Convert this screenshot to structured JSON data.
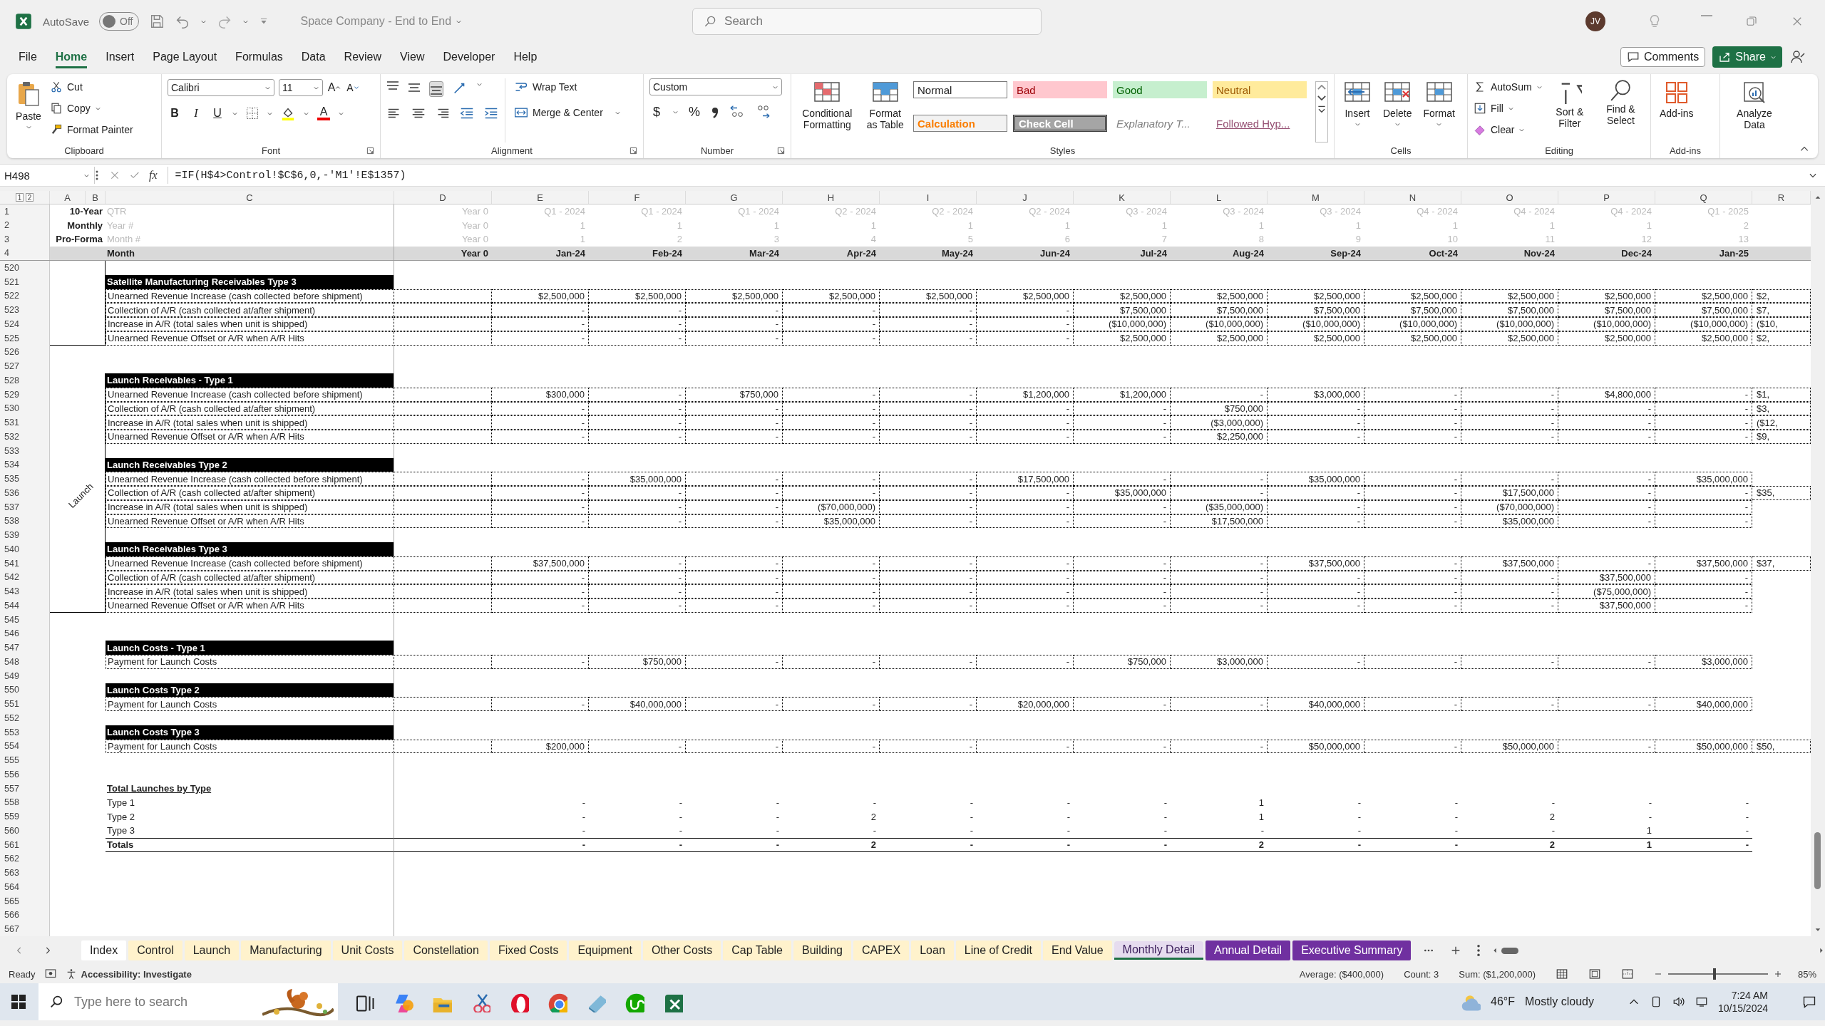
{
  "titlebar": {
    "autosave": "AutoSave",
    "autosave_on": false,
    "toggle": "Off",
    "title": "Space Company - End to End",
    "search": {
      "placeholder": "Search"
    },
    "avatar": "JV"
  },
  "menu_tabs": [
    {
      "label": "File",
      "selected": false
    },
    {
      "label": "Home",
      "selected": true
    },
    {
      "label": "Insert",
      "selected": false
    },
    {
      "label": "Page Layout",
      "selected": false
    },
    {
      "label": "Formulas",
      "selected": false
    },
    {
      "label": "Data",
      "selected": false
    },
    {
      "label": "Review",
      "selected": false
    },
    {
      "label": "View",
      "selected": false
    },
    {
      "label": "Developer",
      "selected": false
    },
    {
      "label": "Help",
      "selected": false
    }
  ],
  "comments": "Comments",
  "share": "Share",
  "ribbon": {
    "clipboard": {
      "paste": "Paste",
      "cut": "Cut",
      "copy": "Copy",
      "format_painter": "Format Painter",
      "label": "Clipboard"
    },
    "font": {
      "family": "Calibri",
      "size": "11",
      "grow": "A",
      "shrink": "A",
      "bold": "B",
      "italic": "I",
      "underline": "U",
      "font_color": "A",
      "label": "Font"
    },
    "alignment": {
      "wrap": "Wrap Text",
      "merge": "Merge & Center",
      "label": "Alignment"
    },
    "number": {
      "format": "Custom",
      "currency": "$",
      "percent": "%",
      "label": "Number"
    },
    "styles": {
      "conditional": "Conditional Formatting",
      "format_table": "Format as Table",
      "cells": [
        {
          "label": "Normal",
          "kind": "normal"
        },
        {
          "label": "Bad",
          "kind": "bad"
        },
        {
          "label": "Good",
          "kind": "good"
        },
        {
          "label": "Neutral",
          "kind": "neutral"
        },
        {
          "label": "Calculation",
          "kind": "calculation"
        },
        {
          "label": "Check Cell",
          "kind": "check"
        },
        {
          "label": "Explanatory T...",
          "kind": "explanatory"
        },
        {
          "label": "Followed Hyp...",
          "kind": "hyperlink"
        }
      ],
      "label": "Styles"
    },
    "cells": {
      "insert": "Insert",
      "delete": "Delete",
      "format": "Format",
      "label": "Cells"
    },
    "editing": {
      "autosum": "AutoSum",
      "fill": "Fill",
      "clear": "Clear",
      "sort": "Sort & Filter",
      "find": "Find & Select",
      "label": "Editing"
    },
    "addins": {
      "button": "Add-ins",
      "label": "Add-ins"
    },
    "analyze": "Analyze Data"
  },
  "formula_bar": {
    "name_box": "H498",
    "fx": "fx",
    "formula": "=IF(H$4>Control!$C$6,0,-'M1'!E$1357)"
  },
  "outline_levels": [
    "1",
    "2"
  ],
  "columns": [
    "A",
    "B",
    "C",
    "D",
    "E",
    "F",
    "G",
    "H",
    "I",
    "J",
    "K",
    "L",
    "M",
    "N",
    "O",
    "P",
    "Q",
    "R"
  ],
  "header_rows": [
    {
      "n": "1",
      "title": "10-Year",
      "label": "QTR",
      "values": [
        "Year 0",
        "Q1 - 2024",
        "Q1 - 2024",
        "Q1 - 2024",
        "Q2 - 2024",
        "Q2 - 2024",
        "Q2 - 2024",
        "Q3 - 2024",
        "Q3 - 2024",
        "Q3 - 2024",
        "Q4 - 2024",
        "Q4 - 2024",
        "Q4 - 2024",
        "Q1 - 2025"
      ],
      "kind": "meta"
    },
    {
      "n": "2",
      "title": "Monthly",
      "label": "Year #",
      "values": [
        "Year 0",
        "1",
        "1",
        "1",
        "1",
        "1",
        "1",
        "1",
        "1",
        "1",
        "1",
        "1",
        "1",
        "2"
      ],
      "kind": "meta"
    },
    {
      "n": "3",
      "title": "Pro-Forma",
      "label": "Month #",
      "values": [
        "Year 0",
        "1",
        "2",
        "3",
        "4",
        "5",
        "6",
        "7",
        "8",
        "9",
        "10",
        "11",
        "12",
        "13"
      ],
      "kind": "meta"
    },
    {
      "n": "4",
      "label": "Month",
      "values": [
        "Year 0",
        "Jan-24",
        "Feb-24",
        "Mar-24",
        "Apr-24",
        "May-24",
        "Jun-24",
        "Jul-24",
        "Aug-24",
        "Sep-24",
        "Oct-24",
        "Nov-24",
        "Dec-24",
        "Jan-25"
      ],
      "kind": "month"
    }
  ],
  "rows": [
    {
      "n": "520",
      "kind": "blank",
      "bracket": true
    },
    {
      "n": "521",
      "kind": "section",
      "bracket": true,
      "label": "Satellite Manufacturing Receivables Type 3"
    },
    {
      "n": "522",
      "kind": "data",
      "bracket": true,
      "label": "Unearned Revenue Increase (cash collected before shipment)",
      "values": [
        "$2,500,000",
        "$2,500,000",
        "$2,500,000",
        "$2,500,000",
        "$2,500,000",
        "$2,500,000",
        "$2,500,000",
        "$2,500,000",
        "$2,500,000",
        "$2,500,000",
        "$2,500,000",
        "$2,500,000",
        "$2,500,000",
        "$2,"
      ]
    },
    {
      "n": "523",
      "kind": "data",
      "bracket": true,
      "label": "Collection of A/R (cash collected at/after shipment)",
      "values": [
        "-",
        "-",
        "-",
        "-",
        "-",
        "-",
        "$7,500,000",
        "$7,500,000",
        "$7,500,000",
        "$7,500,000",
        "$7,500,000",
        "$7,500,000",
        "$7,500,000",
        "$7,"
      ]
    },
    {
      "n": "524",
      "kind": "data",
      "bracket": true,
      "label": "Increase in A/R (total sales when unit is shipped)",
      "values": [
        "-",
        "-",
        "-",
        "-",
        "-",
        "-",
        "($10,000,000)",
        "($10,000,000)",
        "($10,000,000)",
        "($10,000,000)",
        "($10,000,000)",
        "($10,000,000)",
        "($10,000,000)",
        "($10,"
      ]
    },
    {
      "n": "525",
      "kind": "data",
      "bracket": true,
      "label": "Unearned Revenue Offset or A/R when A/R Hits",
      "values": [
        "-",
        "-",
        "-",
        "-",
        "-",
        "-",
        "$2,500,000",
        "$2,500,000",
        "$2,500,000",
        "$2,500,000",
        "$2,500,000",
        "$2,500,000",
        "$2,500,000",
        "$2,"
      ]
    },
    {
      "n": "526",
      "kind": "blank",
      "bracket": false
    },
    {
      "n": "527",
      "kind": "blank",
      "bracket": false
    },
    {
      "n": "528",
      "kind": "section",
      "bracket": true,
      "label": "Launch Receivables - Type 1"
    },
    {
      "n": "529",
      "kind": "data",
      "bracket": true,
      "label": "Unearned Revenue Increase (cash collected before shipment)",
      "values": [
        "$300,000",
        "-",
        "$750,000",
        "-",
        "-",
        "$1,200,000",
        "$1,200,000",
        "-",
        "$3,000,000",
        "-",
        "-",
        "$4,800,000",
        "-",
        "$1,"
      ]
    },
    {
      "n": "530",
      "kind": "data",
      "bracket": true,
      "label": "Collection of A/R (cash collected at/after shipment)",
      "values": [
        "-",
        "-",
        "-",
        "-",
        "-",
        "-",
        "-",
        "$750,000",
        "-",
        "-",
        "-",
        "-",
        "-",
        "$3,"
      ]
    },
    {
      "n": "531",
      "kind": "data",
      "bracket": true,
      "label": "Increase in A/R (total sales when unit is shipped)",
      "values": [
        "-",
        "-",
        "-",
        "-",
        "-",
        "-",
        "-",
        "($3,000,000)",
        "-",
        "-",
        "-",
        "-",
        "-",
        "($12,"
      ]
    },
    {
      "n": "532",
      "kind": "data",
      "bracket": true,
      "label": "Unearned Revenue Offset or A/R when A/R Hits",
      "values": [
        "-",
        "-",
        "-",
        "-",
        "-",
        "-",
        "-",
        "$2,250,000",
        "-",
        "-",
        "-",
        "-",
        "-",
        "$9,"
      ]
    },
    {
      "n": "533",
      "kind": "blank",
      "bracket": true
    },
    {
      "n": "534",
      "kind": "section",
      "bracket": true,
      "label": "Launch Receivables Type 2"
    },
    {
      "n": "535",
      "kind": "data",
      "bracket": true,
      "label": "Unearned Revenue Increase (cash collected before shipment)",
      "values": [
        "-",
        "$35,000,000",
        "-",
        "-",
        "-",
        "$17,500,000",
        "-",
        "-",
        "$35,000,000",
        "-",
        "-",
        "-",
        "$35,000,000"
      ]
    },
    {
      "n": "536",
      "kind": "data",
      "bracket": true,
      "side_label": "Launch",
      "label": "Collection of A/R (cash collected at/after shipment)",
      "values": [
        "-",
        "-",
        "-",
        "-",
        "-",
        "-",
        "$35,000,000",
        "-",
        "-",
        "-",
        "$17,500,000",
        "-",
        "-",
        "$35,"
      ]
    },
    {
      "n": "537",
      "kind": "data",
      "bracket": true,
      "label": "Increase in A/R (total sales when unit is shipped)",
      "values": [
        "-",
        "-",
        "-",
        "($70,000,000)",
        "-",
        "-",
        "-",
        "($35,000,000)",
        "-",
        "-",
        "($70,000,000)",
        "-",
        "-"
      ]
    },
    {
      "n": "538",
      "kind": "data",
      "bracket": true,
      "label": "Unearned Revenue Offset or A/R when A/R Hits",
      "values": [
        "-",
        "-",
        "-",
        "$35,000,000",
        "-",
        "-",
        "-",
        "$17,500,000",
        "-",
        "-",
        "$35,000,000",
        "-",
        "-"
      ]
    },
    {
      "n": "539",
      "kind": "blank",
      "bracket": true
    },
    {
      "n": "540",
      "kind": "section",
      "bracket": true,
      "label": "Launch Receivables Type 3"
    },
    {
      "n": "541",
      "kind": "data",
      "bracket": true,
      "label": "Unearned Revenue Increase (cash collected before shipment)",
      "values": [
        "$37,500,000",
        "-",
        "-",
        "-",
        "-",
        "-",
        "-",
        "-",
        "$37,500,000",
        "-",
        "$37,500,000",
        "-",
        "$37,500,000",
        "$37,"
      ]
    },
    {
      "n": "542",
      "kind": "data",
      "bracket": true,
      "label": "Collection of A/R (cash collected at/after shipment)",
      "values": [
        "-",
        "-",
        "-",
        "-",
        "-",
        "-",
        "-",
        "-",
        "-",
        "-",
        "-",
        "$37,500,000",
        "-"
      ]
    },
    {
      "n": "543",
      "kind": "data",
      "bracket": true,
      "label": "Increase in A/R (total sales when unit is shipped)",
      "values": [
        "-",
        "-",
        "-",
        "-",
        "-",
        "-",
        "-",
        "-",
        "-",
        "-",
        "-",
        "($75,000,000)",
        "-"
      ]
    },
    {
      "n": "544",
      "kind": "data",
      "bracket": true,
      "label": "Unearned Revenue Offset or A/R when A/R Hits",
      "values": [
        "-",
        "-",
        "-",
        "-",
        "-",
        "-",
        "-",
        "-",
        "-",
        "-",
        "-",
        "$37,500,000",
        "-"
      ]
    },
    {
      "n": "545",
      "kind": "blank",
      "bracket": false
    },
    {
      "n": "546",
      "kind": "blank",
      "bracket": false
    },
    {
      "n": "547",
      "kind": "section",
      "bracket": false,
      "label": "Launch Costs - Type 1"
    },
    {
      "n": "548",
      "kind": "data",
      "bracket": false,
      "label": "Payment for Launch Costs",
      "values": [
        "-",
        "$750,000",
        "-",
        "-",
        "-",
        "-",
        "$750,000",
        "$3,000,000",
        "-",
        "-",
        "-",
        "-",
        "$3,000,000"
      ]
    },
    {
      "n": "549",
      "kind": "blank",
      "bracket": false
    },
    {
      "n": "550",
      "kind": "section",
      "bracket": false,
      "label": "Launch Costs Type 2"
    },
    {
      "n": "551",
      "kind": "data",
      "bracket": false,
      "label": "Payment for Launch Costs",
      "values": [
        "-",
        "$40,000,000",
        "-",
        "-",
        "-",
        "$20,000,000",
        "-",
        "-",
        "$40,000,000",
        "-",
        "-",
        "-",
        "$40,000,000"
      ]
    },
    {
      "n": "552",
      "kind": "blank",
      "bracket": false
    },
    {
      "n": "553",
      "kind": "section",
      "bracket": false,
      "label": "Launch Costs Type 3"
    },
    {
      "n": "554",
      "kind": "data",
      "bracket": false,
      "label": "Payment for Launch Costs",
      "values": [
        "$200,000",
        "-",
        "-",
        "-",
        "-",
        "-",
        "-",
        "-",
        "$50,000,000",
        "-",
        "$50,000,000",
        "-",
        "$50,000,000",
        "$50,"
      ]
    },
    {
      "n": "555",
      "kind": "blank",
      "bracket": false
    },
    {
      "n": "556",
      "kind": "blank",
      "bracket": false
    },
    {
      "n": "557",
      "kind": "subtitle",
      "bracket": false,
      "label": "Total Launches by Type"
    },
    {
      "n": "558",
      "kind": "plain",
      "bracket": false,
      "label": "Type 1",
      "values": [
        "-",
        "-",
        "-",
        "-",
        "-",
        "-",
        "-",
        "1",
        "-",
        "-",
        "-",
        "-",
        "-"
      ]
    },
    {
      "n": "559",
      "kind": "plain",
      "bracket": false,
      "label": "Type 2",
      "values": [
        "-",
        "-",
        "-",
        "2",
        "-",
        "-",
        "-",
        "1",
        "-",
        "-",
        "2",
        "-",
        "-"
      ]
    },
    {
      "n": "560",
      "kind": "plain",
      "bracket": false,
      "label": "Type 3",
      "values": [
        "-",
        "-",
        "-",
        "-",
        "-",
        "-",
        "-",
        "-",
        "-",
        "-",
        "-",
        "1",
        "-"
      ]
    },
    {
      "n": "561",
      "kind": "total",
      "bracket": false,
      "label": "Totals",
      "values": [
        "-",
        "-",
        "-",
        "2",
        "-",
        "-",
        "-",
        "2",
        "-",
        "-",
        "2",
        "1",
        "-"
      ]
    },
    {
      "n": "562",
      "kind": "blank",
      "bracket": false
    },
    {
      "n": "563",
      "kind": "blank",
      "bracket": false
    },
    {
      "n": "564",
      "kind": "blank",
      "bracket": false
    },
    {
      "n": "565",
      "kind": "blank",
      "bracket": false
    },
    {
      "n": "566",
      "kind": "blank",
      "bracket": false
    },
    {
      "n": "567",
      "kind": "blank",
      "bracket": false
    }
  ],
  "sheet_tabs": [
    {
      "label": "Index",
      "color": "#ffffff",
      "selected": false
    },
    {
      "label": "Control",
      "color": "#fff2cc",
      "selected": false
    },
    {
      "label": "Launch",
      "color": "#fff2cc",
      "selected": false
    },
    {
      "label": "Manufacturing",
      "color": "#fff2cc",
      "selected": false
    },
    {
      "label": "Unit Costs",
      "color": "#fff2cc",
      "selected": false
    },
    {
      "label": "Constellation",
      "color": "#fff2cc",
      "selected": false
    },
    {
      "label": "Fixed Costs",
      "color": "#fff2cc",
      "selected": false
    },
    {
      "label": "Equipment",
      "color": "#fff2cc",
      "selected": false
    },
    {
      "label": "Other Costs",
      "color": "#fff2cc",
      "selected": false
    },
    {
      "label": "Cap Table",
      "color": "#fff2cc",
      "selected": false
    },
    {
      "label": "Building",
      "color": "#fff2cc",
      "selected": false
    },
    {
      "label": "CAPEX",
      "color": "#fff2cc",
      "selected": false
    },
    {
      "label": "Loan",
      "color": "#fff2cc",
      "selected": false
    },
    {
      "label": "Line of Credit",
      "color": "#fff2cc",
      "selected": false
    },
    {
      "label": "End Value",
      "color": "#fff2cc",
      "selected": false
    },
    {
      "label": "Monthly Detail",
      "color": "#e6dcef",
      "selected": true
    },
    {
      "label": "Annual Detail",
      "color": "#7030a0",
      "selected": false
    },
    {
      "label": "Executive Summary",
      "color": "#7030a0",
      "selected": false
    }
  ],
  "status": {
    "ready": "Ready",
    "accessibility": "Accessibility: Investigate",
    "average": "Average: ($400,000)",
    "count": "Count: 3",
    "sum": "Sum: ($1,200,000)",
    "zoom": {
      "level": 0.45,
      "reading": "85%"
    }
  },
  "taskbar": {
    "search": {
      "placeholder": "Type here to search"
    },
    "temperature": "46°F",
    "weather": "Mostly cloudy",
    "time": "7:24 AM",
    "date": "10/15/2024"
  }
}
